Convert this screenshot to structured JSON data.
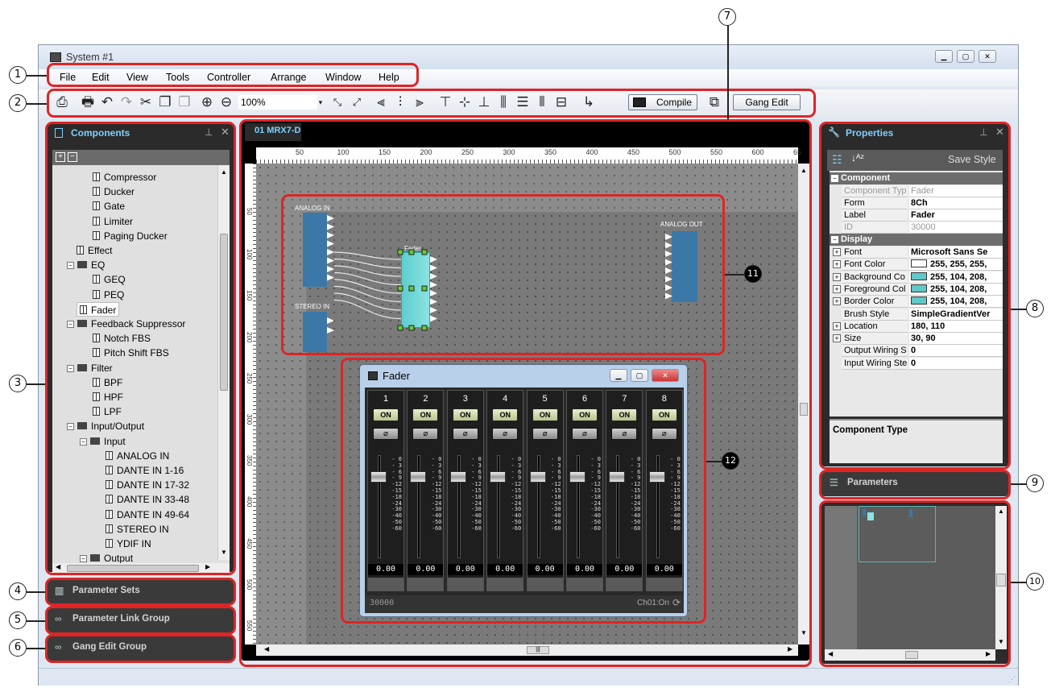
{
  "window": {
    "title": "System #1"
  },
  "menu": [
    "File",
    "Edit",
    "View",
    "Tools",
    "Controller",
    "Arrange",
    "Window",
    "Help"
  ],
  "toolbar": {
    "zoom": "100%",
    "compile_label": "Compile",
    "gang_edit_label": "Gang Edit"
  },
  "components_panel": {
    "title": "Components",
    "tree": [
      {
        "label": "Compressor",
        "type": "item"
      },
      {
        "label": "Ducker",
        "type": "item"
      },
      {
        "label": "Gate",
        "type": "item"
      },
      {
        "label": "Limiter",
        "type": "item"
      },
      {
        "label": "Paging Ducker",
        "type": "item"
      },
      {
        "label": "Effect",
        "type": "item"
      },
      {
        "label": "EQ",
        "type": "folder"
      },
      {
        "label": "GEQ",
        "type": "item"
      },
      {
        "label": "PEQ",
        "type": "item"
      },
      {
        "label": "Fader",
        "type": "item"
      },
      {
        "label": "Feedback Suppressor",
        "type": "folder"
      },
      {
        "label": "Notch FBS",
        "type": "item"
      },
      {
        "label": "Pitch Shift FBS",
        "type": "item"
      },
      {
        "label": "Filter",
        "type": "folder"
      },
      {
        "label": "BPF",
        "type": "item"
      },
      {
        "label": "HPF",
        "type": "item"
      },
      {
        "label": "LPF",
        "type": "item"
      },
      {
        "label": "Input/Output",
        "type": "folder"
      },
      {
        "label": "Input",
        "type": "folder"
      },
      {
        "label": "ANALOG IN",
        "type": "item"
      },
      {
        "label": "DANTE IN 1-16",
        "type": "item"
      },
      {
        "label": "DANTE IN 17-32",
        "type": "item"
      },
      {
        "label": "DANTE IN 33-48",
        "type": "item"
      },
      {
        "label": "DANTE IN 49-64",
        "type": "item"
      },
      {
        "label": "STEREO IN",
        "type": "item"
      },
      {
        "label": "YDIF IN",
        "type": "item"
      },
      {
        "label": "Output",
        "type": "folder"
      }
    ]
  },
  "collapsed_panels": {
    "parameter_sets": "Parameter Sets",
    "parameter_link_group": "Parameter Link Group",
    "gang_edit_group": "Gang Edit Group",
    "parameters": "Parameters"
  },
  "canvas": {
    "tab": "01 MRX7-D",
    "ruler_x": [
      "50",
      "100",
      "150",
      "200",
      "250",
      "300",
      "350",
      "400",
      "450",
      "500",
      "550",
      "600",
      "65"
    ],
    "ruler_y": [
      "50",
      "100",
      "150",
      "200",
      "250",
      "300",
      "350",
      "400",
      "450",
      "500",
      "550"
    ],
    "blocks": {
      "analog_in": "ANALOG IN",
      "stereo_in": "STEREO IN",
      "fader": "Fader",
      "analog_out": "ANALOG OUT"
    }
  },
  "properties": {
    "title": "Properties",
    "save_style": "Save Style",
    "sections": {
      "component": "Component",
      "display": "Display"
    },
    "rows": [
      {
        "k": "Component Typ",
        "v": "Fader",
        "gray": true
      },
      {
        "k": "Form",
        "v": "8Ch"
      },
      {
        "k": "Label",
        "v": "Fader"
      },
      {
        "k": "ID",
        "v": "30000",
        "gray": true
      }
    ],
    "display_rows": [
      {
        "k": "Font",
        "v": "Microsoft Sans Se",
        "exp": true
      },
      {
        "k": "Font Color",
        "v": "255, 255, 255,",
        "exp": true,
        "color": "#ffffff"
      },
      {
        "k": "Background Co",
        "v": "255, 104, 208,",
        "exp": true,
        "color": "#5fc8c8"
      },
      {
        "k": "Foreground Col",
        "v": "255, 104, 208,",
        "exp": true,
        "color": "#5fc8c8"
      },
      {
        "k": "Border Color",
        "v": "255, 104, 208,",
        "exp": true,
        "color": "#5fc8c8"
      },
      {
        "k": "Brush Style",
        "v": "SimpleGradientVer"
      },
      {
        "k": "Location",
        "v": "180, 110",
        "exp": true
      },
      {
        "k": "Size",
        "v": "30, 90",
        "exp": true
      },
      {
        "k": "Output Wiring S",
        "v": "0"
      },
      {
        "k": "Input Wiring Ste",
        "v": "0"
      }
    ],
    "description_title": "Component Type"
  },
  "fader_window": {
    "title": "Fader",
    "channels": [
      "1",
      "2",
      "3",
      "4",
      "5",
      "6",
      "7",
      "8"
    ],
    "on_label": "ON",
    "phase_label": "⌀",
    "scale": [
      "0",
      "3",
      "6",
      "9",
      "12",
      "15",
      "18",
      "24",
      "30",
      "40",
      "50",
      "60"
    ],
    "values": [
      "0.00",
      "0.00",
      "0.00",
      "0.00",
      "0.00",
      "0.00",
      "0.00",
      "0.00"
    ],
    "footer_id": "30000",
    "footer_status": "Ch01:On"
  },
  "callouts": [
    "1",
    "2",
    "3",
    "4",
    "5",
    "6",
    "7",
    "8",
    "9",
    "10",
    "11",
    "12"
  ]
}
